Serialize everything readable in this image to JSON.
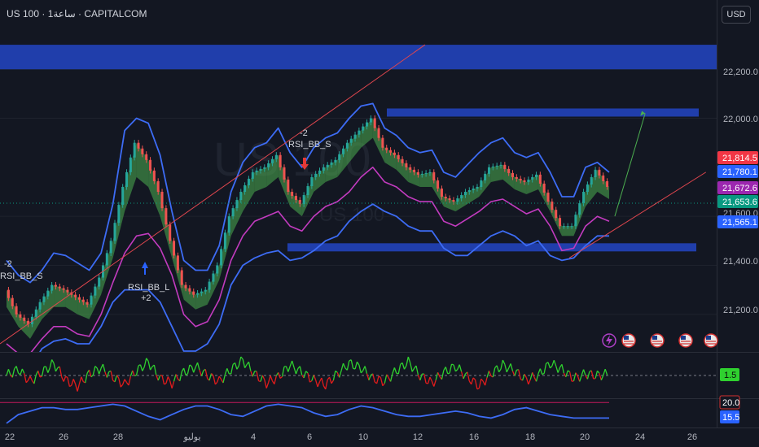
{
  "header": {
    "symbol_title": "US 100 · 1ساعة · CAPITALCOM",
    "currency_label": "USD"
  },
  "watermark": {
    "symbol": "US 100",
    "name": "US 100"
  },
  "colors": {
    "background": "#131722",
    "zone_blue": "#2140b3",
    "band_blue": "#3d6cf5",
    "bull_cloud": "#4caf50",
    "bear_cloud": "#e05050",
    "ma_magenta": "#c23bbf",
    "trendline_red": "#e0464e",
    "projection_green": "#4caf50",
    "osc_green": "#2fd02f",
    "osc_red": "#e21c1c"
  },
  "icons": [
    "lightning-icon",
    "us-flag-icon",
    "us-flag-icon",
    "us-flag-icon",
    "us-flag-icon"
  ],
  "chart_data": [
    {
      "type": "line",
      "panel": "price",
      "ylim": [
        21050,
        22350
      ],
      "y_ticks": [
        "22,200.0",
        "22,000.0",
        "21,600.0",
        "21,400.0",
        "21,200.0"
      ],
      "x_tick_labels": [
        "22",
        "26",
        "28",
        "يوليو",
        "4",
        "6",
        "10",
        "12",
        "16",
        "18",
        "20",
        "24",
        "26"
      ],
      "zones": [
        {
          "y1": 22200,
          "y2": 22300,
          "label": "resistance-zone-top"
        },
        {
          "y1": 22010,
          "y2": 22040,
          "label": "resistance-zone"
        },
        {
          "y1": 21460,
          "y2": 21490,
          "label": "support-zone"
        }
      ],
      "price_tags": [
        {
          "value": "21,814.5",
          "color": "#f23645"
        },
        {
          "value": "21,780.1",
          "color": "#2962ff"
        },
        {
          "value": "21,672.6",
          "color": "#9c27b0"
        },
        {
          "value": "21,653.6",
          "color": "#089981"
        },
        {
          "value": "21,565.1",
          "color": "#2962ff"
        }
      ],
      "annotations": [
        {
          "text": "-2"
        },
        {
          "text": "RSI_BB_S"
        },
        {
          "text": "-2"
        },
        {
          "text": "RSI_BB_S"
        },
        {
          "text": "RSI_BB_L"
        },
        {
          "text": "+2"
        }
      ],
      "series": [
        {
          "values": [
            21300,
            21200,
            21160,
            21250,
            21320,
            21300,
            21270,
            21240,
            21350,
            21500,
            21720,
            21900,
            21830,
            21700,
            21500,
            21320,
            21280,
            21300,
            21400,
            21600,
            21700,
            21780,
            21800,
            21850,
            21700,
            21650,
            21760,
            21800,
            21830,
            21900,
            21950,
            22000,
            21880,
            21850,
            21800,
            21770,
            21780,
            21680,
            21660,
            21700,
            21720,
            21800,
            21810,
            21760,
            21740,
            21770,
            21660,
            21560,
            21560,
            21700,
            21790,
            21720
          ]
        },
        {
          "values": [
            21230,
            21150,
            21100,
            21180,
            21230,
            21230,
            21200,
            21180,
            21280,
            21430,
            21620,
            21760,
            21720,
            21600,
            21430,
            21260,
            21220,
            21240,
            21340,
            21520,
            21620,
            21700,
            21720,
            21760,
            21640,
            21600,
            21700,
            21740,
            21760,
            21820,
            21880,
            21920,
            21820,
            21790,
            21740,
            21720,
            21720,
            21640,
            21620,
            21650,
            21680,
            21740,
            21750,
            21710,
            21690,
            21710,
            21620,
            21520,
            21520,
            21640,
            21700,
            21670
          ]
        },
        {
          "values": [
            21080,
            21040,
            21040,
            21100,
            21150,
            21150,
            21120,
            21110,
            21200,
            21330,
            21450,
            21520,
            21530,
            21470,
            21360,
            21200,
            21150,
            21170,
            21260,
            21420,
            21520,
            21580,
            21600,
            21620,
            21560,
            21540,
            21600,
            21640,
            21660,
            21700,
            21760,
            21800,
            21740,
            21720,
            21680,
            21660,
            21660,
            21580,
            21560,
            21590,
            21620,
            21660,
            21670,
            21640,
            21610,
            21630,
            21560,
            21460,
            21470,
            21560,
            21600,
            21580
          ]
        },
        {
          "values": [
            21420,
            21360,
            21330,
            21380,
            21450,
            21440,
            21410,
            21380,
            21450,
            21650,
            21950,
            22000,
            21980,
            21850,
            21620,
            21420,
            21380,
            21380,
            21480,
            21700,
            21820,
            21880,
            21900,
            21960,
            21860,
            21800,
            21880,
            21920,
            21940,
            22000,
            22050,
            22060,
            21960,
            21930,
            21880,
            21860,
            21870,
            21780,
            21760,
            21810,
            21860,
            21900,
            21920,
            21860,
            21840,
            21860,
            21780,
            21680,
            21680,
            21800,
            21820,
            21780
          ]
        },
        {
          "values": [
            20980,
            20990,
            20980,
            21060,
            21090,
            21100,
            21080,
            21080,
            21150,
            21250,
            21300,
            21300,
            21300,
            21250,
            21150,
            21050,
            21050,
            21080,
            21160,
            21320,
            21400,
            21430,
            21450,
            21460,
            21420,
            21430,
            21460,
            21500,
            21520,
            21580,
            21620,
            21650,
            21620,
            21600,
            21560,
            21540,
            21540,
            21470,
            21440,
            21440,
            21480,
            21520,
            21540,
            21520,
            21480,
            21500,
            21440,
            21420,
            21430,
            21480,
            21520,
            21520
          ]
        }
      ],
      "lines": [
        {
          "from": [
            0.0,
            21080
          ],
          "to": [
            0.56,
            22300
          ],
          "label": "rising-trendline"
        },
        {
          "from": [
            0.75,
            21430
          ],
          "to": [
            0.93,
            21780
          ],
          "label": "lower-trendline"
        },
        {
          "from": [
            0.81,
            21600
          ],
          "to": [
            0.85,
            22020
          ],
          "label": "projection-arrow"
        }
      ]
    },
    {
      "type": "line",
      "panel": "oscillator-1",
      "level_label": "1.5",
      "values": [
        1.5,
        1.9,
        1.1,
        1.7,
        2.3,
        1.2,
        0.8,
        1.6,
        2.0,
        1.4,
        0.9,
        1.8,
        2.4,
        1.3,
        1.0,
        1.7,
        2.1,
        1.5,
        1.1,
        1.9,
        2.5,
        1.6,
        1.0,
        1.4,
        2.2,
        1.7,
        1.2,
        0.9,
        1.6,
        2.3,
        2.0,
        1.3,
        1.1,
        1.8,
        2.4,
        1.5,
        1.0,
        1.7,
        2.1,
        1.4,
        0.8,
        1.6,
        2.2,
        1.8,
        1.2,
        1.5,
        2.3,
        1.9,
        1.3,
        1.6,
        1.5,
        1.6
      ]
    },
    {
      "type": "line",
      "panel": "oscillator-2",
      "level_labels": [
        "20.0",
        "15.5"
      ],
      "values": [
        14.0,
        16.5,
        17.5,
        18.5,
        18.5,
        18.0,
        18.0,
        18.5,
        19.0,
        19.5,
        19.0,
        17.5,
        16.0,
        15.0,
        16.5,
        18.0,
        19.0,
        19.0,
        18.0,
        16.5,
        16.0,
        17.5,
        19.0,
        19.5,
        19.0,
        18.5,
        17.0,
        16.0,
        16.5,
        18.0,
        19.0,
        18.5,
        17.5,
        16.5,
        16.0,
        16.0,
        16.5,
        17.0,
        17.5,
        17.0,
        16.0,
        15.5,
        16.5,
        18.0,
        18.5,
        17.5,
        16.5,
        16.0,
        15.5,
        15.5,
        15.5,
        15.5
      ]
    }
  ]
}
